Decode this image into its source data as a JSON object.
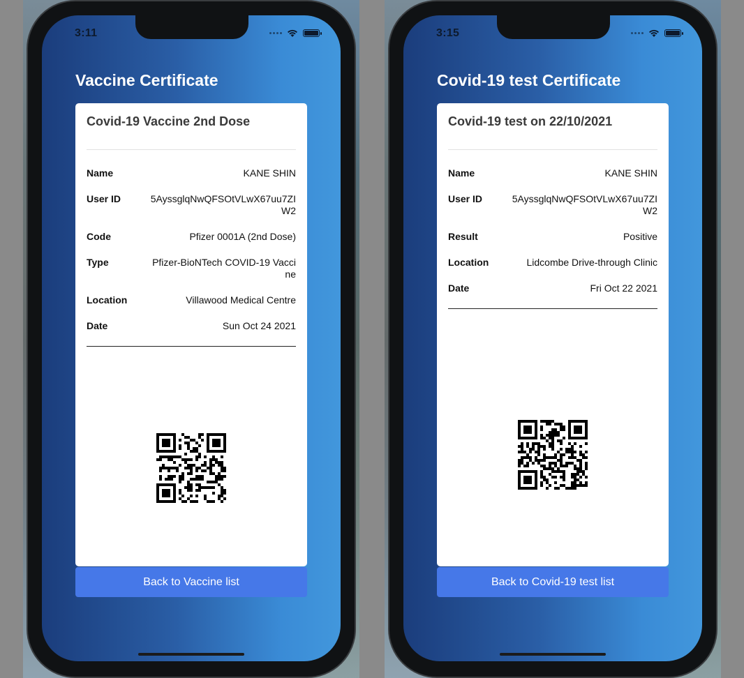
{
  "left_phone": {
    "status_time": "3:11",
    "title": "Vaccine Certificate",
    "card_title": "Covid-19 Vaccine 2nd Dose",
    "rows": [
      {
        "label": "Name",
        "value": "KANE SHIN"
      },
      {
        "label": "User ID",
        "value": "5AyssglqNwQFSOtVLwX67uu7ZIW2"
      },
      {
        "label": "Code",
        "value": "Pfizer 0001A (2nd Dose)"
      },
      {
        "label": "Type",
        "value": "Pfizer-BioNTech COVID-19 Vaccine"
      },
      {
        "label": "Location",
        "value": "Villawood Medical Centre"
      },
      {
        "label": "Date",
        "value": "Sun Oct 24 2021"
      }
    ],
    "button_label": "Back to Vaccine list"
  },
  "right_phone": {
    "status_time": "3:15",
    "title": "Covid-19 test Certificate",
    "card_title": "Covid-19 test on 22/10/2021",
    "rows": [
      {
        "label": "Name",
        "value": "KANE SHIN"
      },
      {
        "label": "User ID",
        "value": "5AyssglqNwQFSOtVLwX67uu7ZIW2"
      },
      {
        "label": "Result",
        "value": "Positive"
      },
      {
        "label": "Location",
        "value": "Lidcombe Drive-through Clinic"
      },
      {
        "label": "Date",
        "value": "Fri Oct 22 2021"
      }
    ],
    "button_label": "Back to Covid-19 test list"
  },
  "icons": {
    "wifi": "wifi-icon",
    "battery": "battery-icon",
    "signal": "signal-icon",
    "qr": "qr-code"
  },
  "colors": {
    "gradient_start": "#1b3d7c",
    "gradient_end": "#4297dc",
    "button": "#4678e8",
    "card": "#ffffff"
  }
}
